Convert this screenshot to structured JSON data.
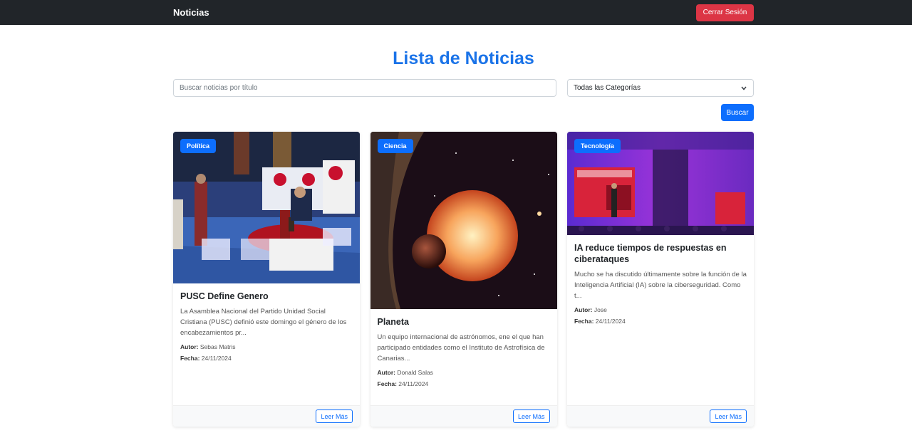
{
  "navbar": {
    "brand": "Noticias",
    "logout_label": "Cerrar Sesión"
  },
  "page": {
    "title": "Lista de Noticias"
  },
  "filters": {
    "search_placeholder": "Buscar noticias por título",
    "category_selected": "Todas las Categorías",
    "search_button": "Buscar"
  },
  "colors": {
    "primary": "#0d6efd",
    "danger": "#dc3545",
    "title": "#1a73e8",
    "navbar": "#212529"
  },
  "news": [
    {
      "category": "Política",
      "title": "PUSC Define Genero",
      "description": "La Asamblea Nacional del Partido Unidad Social Cristiana (PUSC) definió este domingo el género de los encabezamientos pr...",
      "author_label": "Autor:",
      "author": "Sebas Matris",
      "date_label": "Fecha:",
      "date": "24/11/2024",
      "read_more": "Leer Más",
      "image_icon": "political-event-photo"
    },
    {
      "category": "Ciencia",
      "title": "Planeta",
      "description": "Un equipo internacional de astrónomos, ene el que han participado entidades como el Instituto de Astrofísica de Canarias...",
      "author_label": "Autor:",
      "author": "Donald Salas",
      "date_label": "Fecha:",
      "date": "24/11/2024",
      "read_more": "Leer Más",
      "image_icon": "planet-star-photo"
    },
    {
      "category": "Tecnología",
      "title": "IA reduce tiempos de respuestas en ciberataques",
      "description": "Mucho se ha discutido últimamente sobre la función de la Inteligencia Artificial (IA) sobre la ciberseguridad. Como t...",
      "author_label": "Autor:",
      "author": "Jose",
      "date_label": "Fecha:",
      "date": "24/11/2024",
      "read_more": "Leer Más",
      "image_icon": "tech-conference-photo"
    }
  ]
}
